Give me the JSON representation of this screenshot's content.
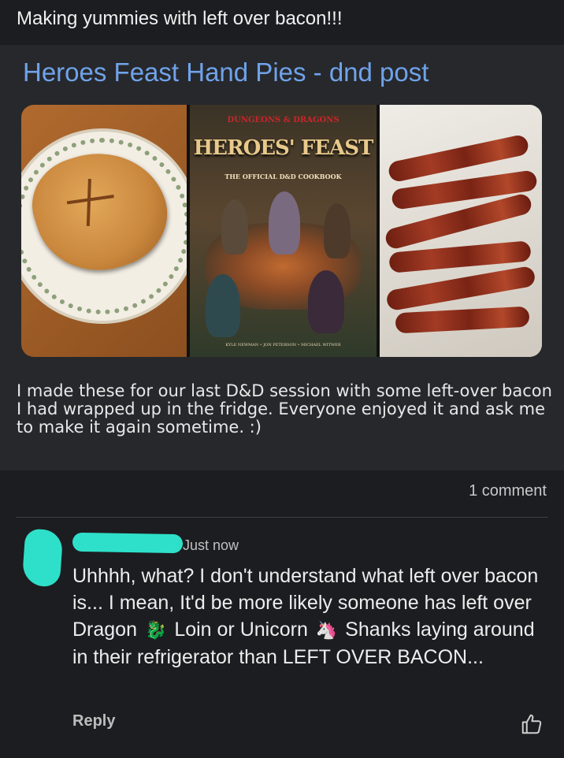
{
  "post": {
    "caption": "Making yummies with left over bacon!!!",
    "link_title": "Heroes Feast Hand Pies - dnd post",
    "book_cover": {
      "brand": "DUNGEONS & DRAGONS",
      "title": "HEROES' FEAST",
      "subtitle": "THE OFFICIAL D&D COOKBOOK",
      "authors": "KYLE NEWMAN • JON PETERSON • MICHAEL WITWER"
    },
    "body": "I made these for our last D&D session with some left-over bacon I had wrapped up in the fridge. Everyone enjoyed it and ask me to make it again sometime.  :)",
    "comment_count": "1 comment"
  },
  "comment": {
    "time": "Just now",
    "text_1": "Uhhhh, what? I don't understand what left over bacon is... I mean, It'd be more likely someone has left over Dragon",
    "text_2": "Loin or Unicorn",
    "text_3": "Shanks laying around in their refrigerator than LEFT OVER BACON...",
    "emoji_dragon": "🐉",
    "emoji_unicorn": "🦄",
    "reply_label": "Reply"
  },
  "icons": {
    "like": "thumbs-up-icon"
  },
  "colors": {
    "background": "#1c1d20",
    "card": "#27282c",
    "link": "#6fa3ea",
    "redaction": "#2ee0c9"
  }
}
